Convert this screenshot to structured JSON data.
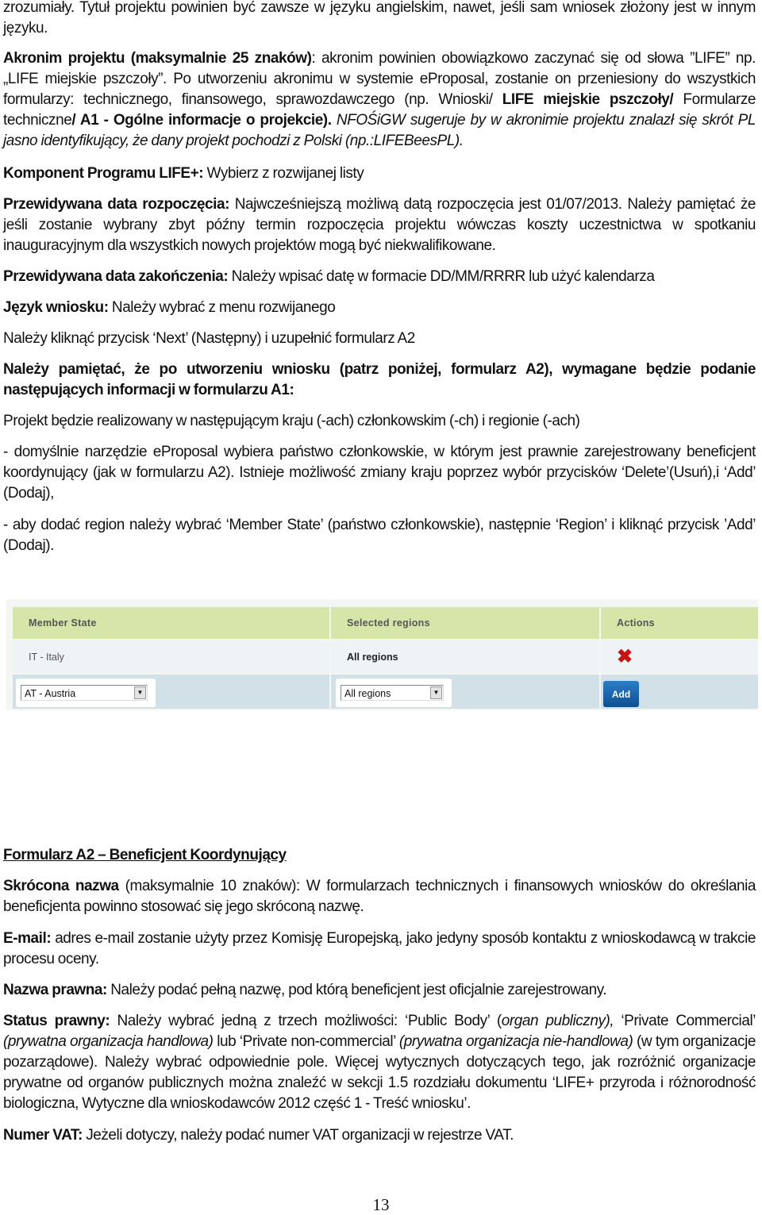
{
  "paragraphs": [
    {
      "id": "p0",
      "segs": [
        {
          "t": "zrozumiały. Tytuł projektu powinien być zawsze w języku angielskim, nawet, jeśli sam wniosek złożony jest w innym języku.",
          "s": "n"
        }
      ]
    },
    {
      "id": "p1",
      "segs": [
        {
          "t": "Akronim projektu (maksymalnie 25 znaków)",
          "s": "b"
        },
        {
          "t": ": akronim powinien obowiązkowo zaczynać się od słowa ”LIFE” np. „LIFE miejskie pszczoły”. Po utworzeniu akronimu w systemie eProposal, zostanie on przeniesiony do wszystkich formularzy: technicznego, finansowego, sprawozdawczego (np. Wnioski/ ",
          "s": "n"
        },
        {
          "t": "LIFE miejskie pszczoły/",
          "s": "b"
        },
        {
          "t": " Formularze techniczne",
          "s": "n"
        },
        {
          "t": "/ A1 - Ogólne informacje o projekcie).",
          "s": "b"
        },
        {
          "t": " NFOŚiGW sugeruje by w akronimie projektu znalazł się skrót PL jasno identyfikujący, że dany projekt pochodzi z Polski (np.:LIFEBeesPL).",
          "s": "i"
        }
      ]
    },
    {
      "id": "p2",
      "segs": [
        {
          "t": "Komponent Programu LIFE+:",
          "s": "b"
        },
        {
          "t": " Wybierz z rozwijanej listy",
          "s": "n"
        }
      ]
    },
    {
      "id": "p3",
      "segs": [
        {
          "t": "Przewidywana data rozpoczęcia:",
          "s": "b"
        },
        {
          "t": " Najwcześniejszą możliwą datą rozpoczęcia jest 01/07/2013. Należy pamiętać że jeśli zostanie wybrany zbyt późny termin rozpoczęcia projektu wówczas koszty uczestnictwa w spotkaniu inauguracyjnym dla wszystkich nowych projektów mogą być niekwalifikowane.",
          "s": "n"
        }
      ]
    },
    {
      "id": "p4",
      "segs": [
        {
          "t": "Przewidywana data zakończenia:",
          "s": "b"
        },
        {
          "t": " Należy wpisać datę w formacie DD/MM/RRRR lub użyć kalendarza",
          "s": "n"
        }
      ]
    },
    {
      "id": "p5",
      "segs": [
        {
          "t": "Język wniosku:",
          "s": "b"
        },
        {
          "t": " Należy wybrać z menu rozwijanego",
          "s": "n"
        }
      ]
    },
    {
      "id": "p6",
      "segs": [
        {
          "t": "Należy  kliknąć przycisk ‘Next’ (Następny) i uzupełnić formularz A2",
          "s": "n"
        }
      ]
    },
    {
      "id": "p7",
      "segs": [
        {
          "t": "Należy pamiętać, że po utworzeniu wniosku (patrz poniżej, formularz A2), wymagane będzie podanie następujących informacji w formularzu A1:",
          "s": "b"
        }
      ]
    },
    {
      "id": "p8",
      "segs": [
        {
          "t": "Projekt będzie realizowany w następującym kraju (-ach) członkowskim (-ch) i regionie (-ach)",
          "s": "n"
        }
      ]
    },
    {
      "id": "p9",
      "segs": [
        {
          "t": "- domyślnie narzędzie eProposal wybiera państwo członkowskie, w którym jest prawnie zarejestrowany beneficjent koordynujący (jak w formularzu A2). Istnieje możliwość zmiany kraju poprzez wybór przycisków ‘Delete’(Usuń),i ‘Add’ (Dodaj),",
          "s": "n"
        }
      ]
    },
    {
      "id": "p10",
      "segs": [
        {
          "t": "- aby dodać region należy wybrać ‘Member State’ (państwo członkowskie), następnie ‘Region’ i kliknąć przycisk ’Add’ (Dodaj).",
          "s": "n"
        }
      ]
    },
    {
      "id": "p11",
      "segs": [
        {
          "t": "Formularz A2 – Beneficjent Koordynujący",
          "s": "h"
        }
      ]
    },
    {
      "id": "p12",
      "segs": [
        {
          "t": "Skrócona nazwa",
          "s": "b"
        },
        {
          "t": " (maksymalnie 10 znaków): W formularzach technicznych i finansowych wniosków do określania beneficjenta powinno stosować się jego skróconą nazwę.",
          "s": "n"
        }
      ]
    },
    {
      "id": "p13",
      "segs": [
        {
          "t": "E-mail:",
          "s": "b"
        },
        {
          "t": " adres e-mail zostanie użyty przez Komisję Europejską, jako jedyny sposób kontaktu z wnioskodawcą w trakcie procesu oceny.",
          "s": "n"
        }
      ]
    },
    {
      "id": "p14",
      "segs": [
        {
          "t": "Nazwa prawna:",
          "s": "b"
        },
        {
          "t": " Należy podać pełną nazwę, pod którą beneficjent jest oficjalnie zarejestrowany.",
          "s": "n"
        }
      ]
    },
    {
      "id": "p15",
      "segs": [
        {
          "t": "Status prawny:",
          "s": "b"
        },
        {
          "t": " Należy wybrać jedną z trzech możliwości: ‘Public Body’ (",
          "s": "n"
        },
        {
          "t": "organ publiczny),",
          "s": "i"
        },
        {
          "t": " ‘Private Commercial’ ",
          "s": "n"
        },
        {
          "t": "(prywatna organizacja handlowa)",
          "s": "i"
        },
        {
          "t": " lub ‘Private non-commercial’ ",
          "s": "n"
        },
        {
          "t": "(prywatna organizacja nie-handlowa)",
          "s": "i"
        },
        {
          "t": " (w tym organizacje pozarządowe). Należy wybrać odpowiednie pole. Więcej wytycznych dotyczących tego, jak rozróżnić organizacje prywatne od organów publicznych można znaleźć w sekcji 1.5 rozdziału dokumentu ‘LIFE+ przyroda i różnorodność biologiczna, Wytyczne dla wnioskodawców 2012 część 1 - Treść wniosku’.",
          "s": "n"
        }
      ]
    },
    {
      "id": "p16",
      "segs": [
        {
          "t": "Numer VAT:",
          "s": "b"
        },
        {
          "t": " Jeżeli dotyczy, należy podać numer VAT organizacji w rejestrze VAT.",
          "s": "n"
        }
      ]
    }
  ],
  "table": {
    "headers": [
      "Member State",
      "Selected regions",
      "Actions"
    ],
    "row": {
      "member_state": "IT - Italy",
      "regions": "All regions",
      "action_icon": "delete-x-icon"
    },
    "member_state_select": "AT - Austria",
    "regions_select": "All regions",
    "add_label": "Add",
    "colors": {
      "header": "#d6e6a8",
      "row": "#eef3f6",
      "input_row": "#d2e0e8",
      "delete": "#cc1111",
      "add": "#1565ad"
    }
  },
  "page_number": "13"
}
